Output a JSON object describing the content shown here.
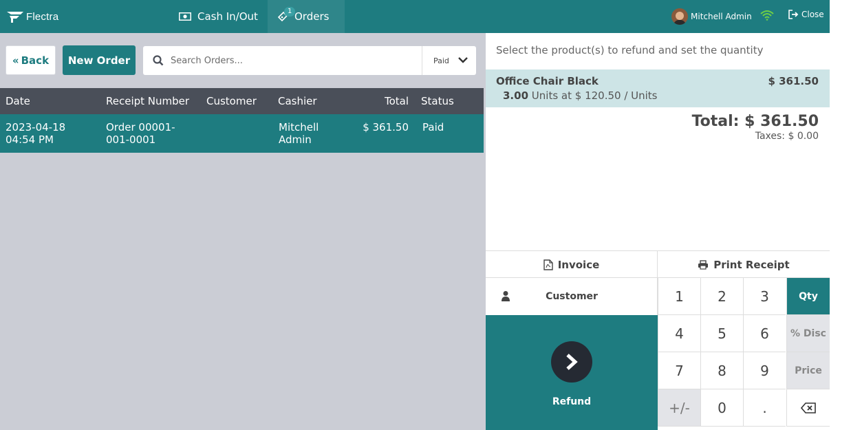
{
  "topbar": {
    "logo_text": "Flectra",
    "cash_label": "Cash In/Out",
    "orders_label": "Orders",
    "orders_badge": "1",
    "user_name": "Mitchell Admin",
    "close_label": "Close"
  },
  "toolbar": {
    "back_label": "Back",
    "new_order_label": "New Order",
    "search_placeholder": "Search Orders...",
    "filter_value": "Paid"
  },
  "table": {
    "headers": {
      "date": "Date",
      "receipt": "Receipt Number",
      "customer": "Customer",
      "cashier": "Cashier",
      "total": "Total",
      "status": "Status"
    },
    "rows": [
      {
        "date_line1": "2023-04-18",
        "date_line2": "04:54 PM",
        "receipt_line1": "Order 00001-",
        "receipt_line2": "001-0001",
        "customer": "",
        "cashier_line1": "Mitchell",
        "cashier_line2": "Admin",
        "total": "$ 361.50",
        "status": "Paid"
      }
    ]
  },
  "refund_panel": {
    "hint": "Select the product(s) to refund and set the quantity",
    "line": {
      "product": "Office Chair Black",
      "price": "$ 361.50",
      "qty": "3.00",
      "detail": "Units at $ 120.50 / Units"
    },
    "total": "Total: $ 361.50",
    "taxes": "Taxes: $ 0.00",
    "invoice_label": "Invoice",
    "print_label": "Print Receipt",
    "customer_label": "Customer",
    "refund_label": "Refund"
  },
  "numpad": {
    "k1": "1",
    "k2": "2",
    "k3": "3",
    "k4": "4",
    "k5": "5",
    "k6": "6",
    "k7": "7",
    "k8": "8",
    "k9": "9",
    "k0": "0",
    "plusminus": "+/-",
    "dot": ".",
    "qty": "Qty",
    "disc": "% Disc",
    "price": "Price"
  },
  "colors": {
    "brand": "#1e7c80",
    "header_dark": "#4a4f59",
    "panel_bg": "#cbcdd5",
    "selected_line": "#cde4e6"
  }
}
